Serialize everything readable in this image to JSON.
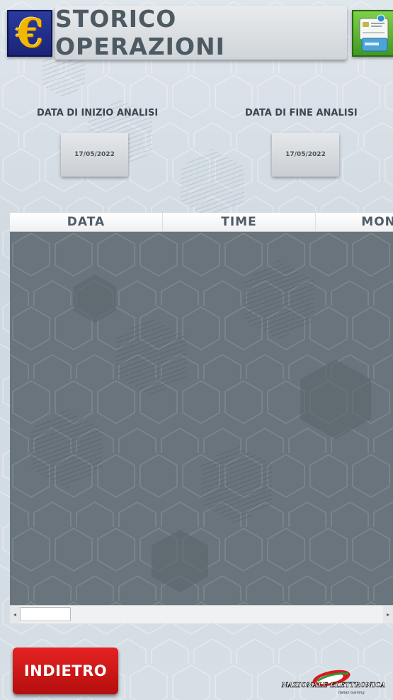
{
  "header": {
    "title": "STORICO OPERAZIONI",
    "left_icon": "euro-icon",
    "right_icon": "credit-card-icon"
  },
  "dates": {
    "start_label": "DATA DI INIZIO ANALISI",
    "start_value": "17/05/2022",
    "end_label": "DATA DI FINE ANALISI",
    "end_value": "17/05/2022"
  },
  "table": {
    "columns": [
      "DATA",
      "TIME",
      "MONETE"
    ],
    "rows": []
  },
  "footer": {
    "back_label": "INDIETRO",
    "logo_text": "NAZIONALE ELETTRONICA",
    "logo_sub": "Italian Gaming"
  },
  "colors": {
    "accent_red": "#d41818",
    "euro_blue": "#1f2b8a",
    "card_green": "#4fb22c",
    "table_body": "#6a747c"
  }
}
